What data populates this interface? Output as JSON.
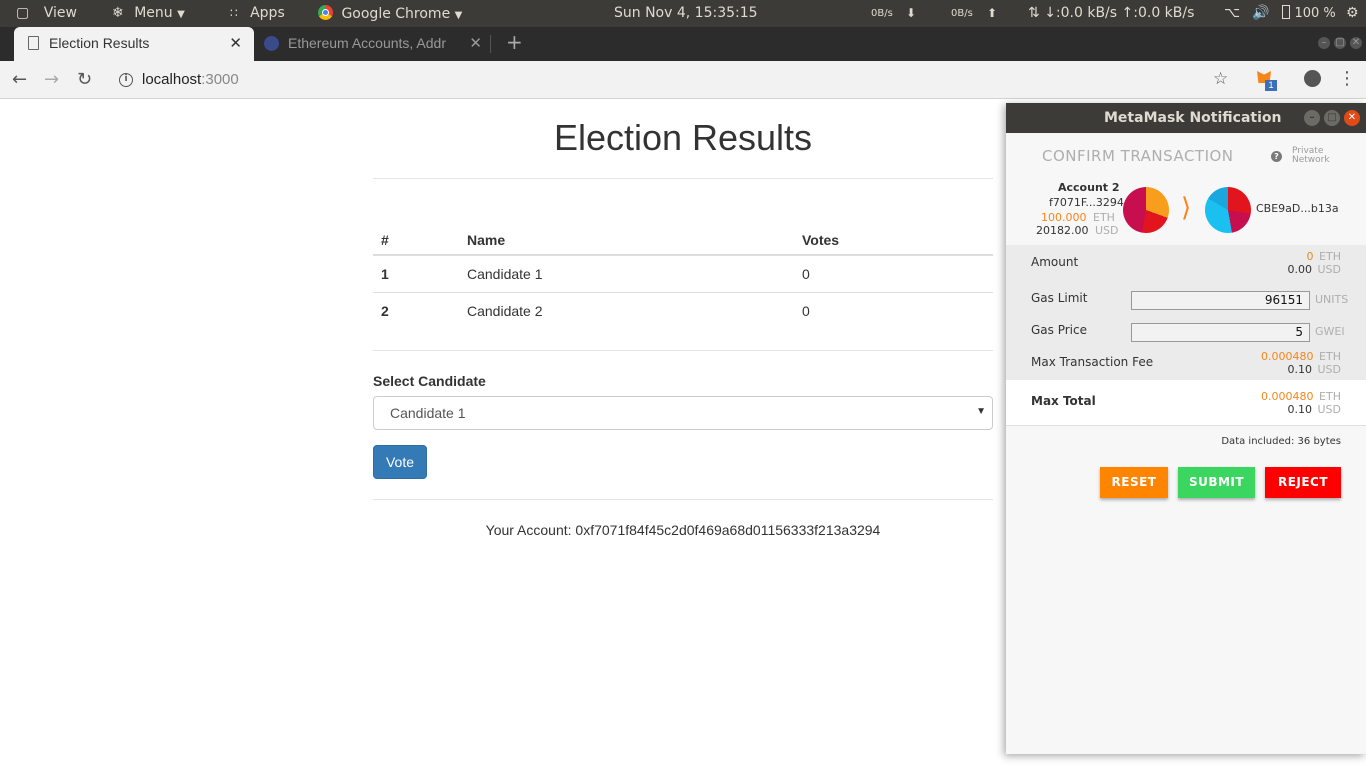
{
  "system_bar": {
    "view_label": "View",
    "menu_label": "Menu",
    "apps_label": "Apps",
    "app_name": "Google Chrome",
    "datetime": "Sun Nov  4, 15:35:15",
    "net_down": "0B/s",
    "net_up": "0B/s",
    "net_total": "↓:0.0 kB/s ↑:0.0 kB/s",
    "battery": "100 %"
  },
  "tabs": [
    {
      "title": "Election Results"
    },
    {
      "title": "Ethereum Accounts, Addr"
    }
  ],
  "address_bar": {
    "host": "localhost",
    "port": ":3000",
    "extension_badge": "1"
  },
  "page": {
    "title": "Election Results",
    "table": {
      "headers": [
        "#",
        "Name",
        "Votes"
      ],
      "rows": [
        {
          "id": "1",
          "name": "Candidate 1",
          "votes": "0"
        },
        {
          "id": "2",
          "name": "Candidate 2",
          "votes": "0"
        }
      ]
    },
    "select_label": "Select Candidate",
    "selected_candidate": "Candidate 1",
    "vote_button": "Vote",
    "account_line": "Your Account: 0xf7071f84f45c2d0f469a68d01156333f213a3294"
  },
  "metamask": {
    "window_title": "MetaMask Notification",
    "heading": "CONFIRM TRANSACTION",
    "network_line1": "Private",
    "network_line2": "Network",
    "from": {
      "account_name": "Account 2",
      "address": "f7071F...3294",
      "eth_balance": "100.000",
      "eth_unit": "ETH",
      "usd_balance": "20182.00",
      "usd_unit": "USD"
    },
    "to_address": "CBE9aD...b13a",
    "amount": {
      "label": "Amount",
      "eth": "0",
      "eth_unit": "ETH",
      "usd": "0.00",
      "usd_unit": "USD"
    },
    "gas_limit": {
      "label": "Gas Limit",
      "value": "96151",
      "unit": "UNITS"
    },
    "gas_price": {
      "label": "Gas Price",
      "value": "5",
      "unit": "GWEI"
    },
    "max_fee": {
      "label": "Max Transaction Fee",
      "eth": "0.000480",
      "eth_unit": "ETH",
      "usd": "0.10",
      "usd_unit": "USD"
    },
    "max_total": {
      "label": "Max Total",
      "eth": "0.000480",
      "eth_unit": "ETH",
      "usd": "0.10",
      "usd_unit": "USD"
    },
    "data_included": "Data included: 36 bytes",
    "buttons": {
      "reset": "RESET",
      "submit": "SUBMIT",
      "reject": "REJECT"
    },
    "colors": {
      "reset": "#ff8400",
      "submit": "#3bd65f",
      "reject": "#ff0000"
    }
  }
}
